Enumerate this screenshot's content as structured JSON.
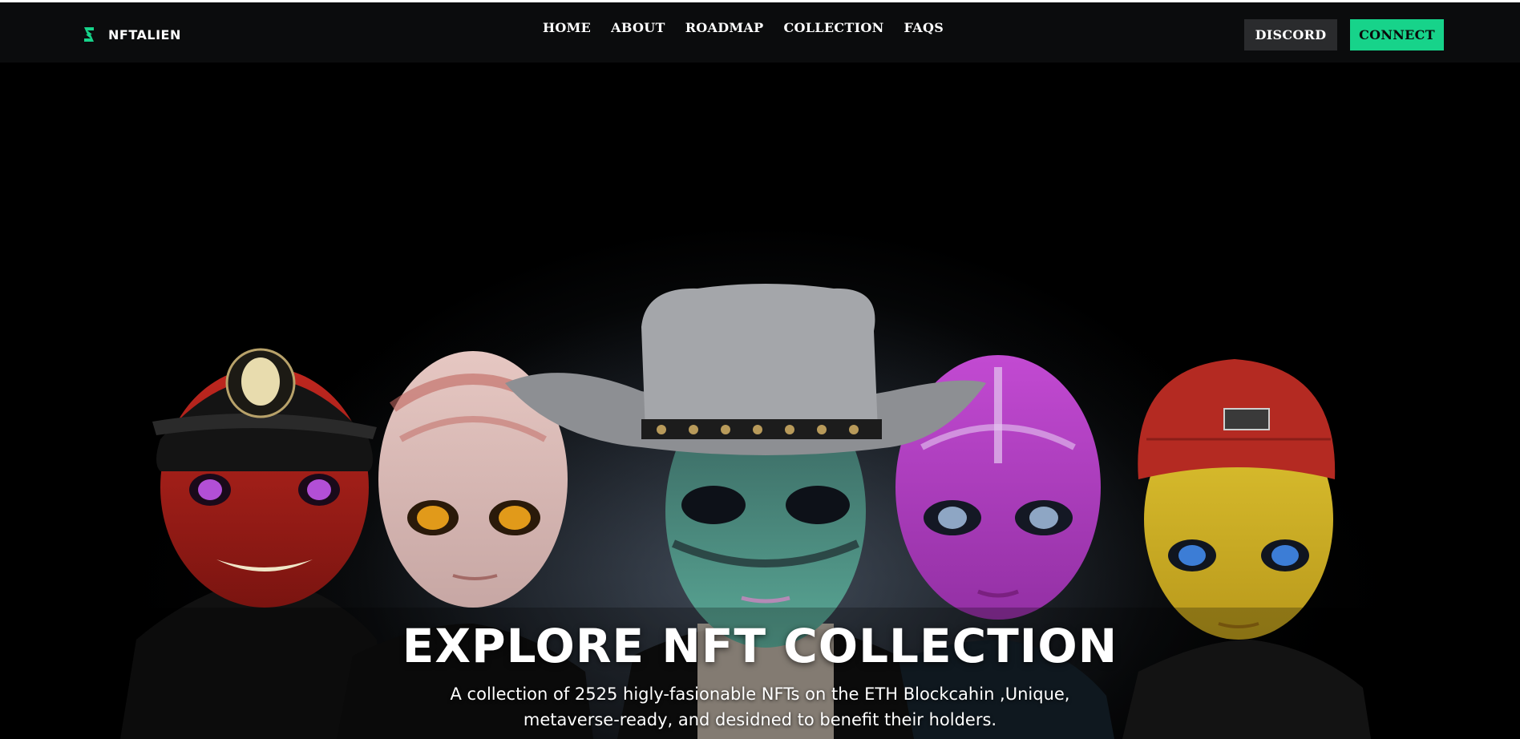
{
  "brand": {
    "name": "NFTALIEN",
    "logo_icon": "nft-alien-logo-icon",
    "accent": "#17d38a"
  },
  "nav": {
    "items": [
      {
        "label": "HOME"
      },
      {
        "label": "ABOUT"
      },
      {
        "label": "ROADMAP"
      },
      {
        "label": "COLLECTION"
      },
      {
        "label": "FAQS"
      }
    ]
  },
  "actions": {
    "discord_label": "DISCORD",
    "connect_label": "CONNECT",
    "discord_color": "#2a2b2d",
    "connect_color": "#17d38a"
  },
  "hero": {
    "image_description_icon": "alien-characters-illustration",
    "title": "EXPLORE NFT COLLECTION",
    "subtitle_line1": "A collection of 2525 higly-fasionable NFTs on the ETH Blockcahin ,Unique,",
    "subtitle_line2": "metaverse-ready, and desidned to benefit their holders.",
    "characters": [
      {
        "name": "red-alien-with-cap",
        "skin": "#b3261e"
      },
      {
        "name": "pale-pink-alien",
        "skin": "#d9b3b0"
      },
      {
        "name": "teal-alien-with-cowboy-hat",
        "skin": "#4e9c8e"
      },
      {
        "name": "purple-alien",
        "skin": "#b13ec0"
      },
      {
        "name": "yellow-alien-with-beanie",
        "skin": "#d8bb2a"
      }
    ]
  }
}
